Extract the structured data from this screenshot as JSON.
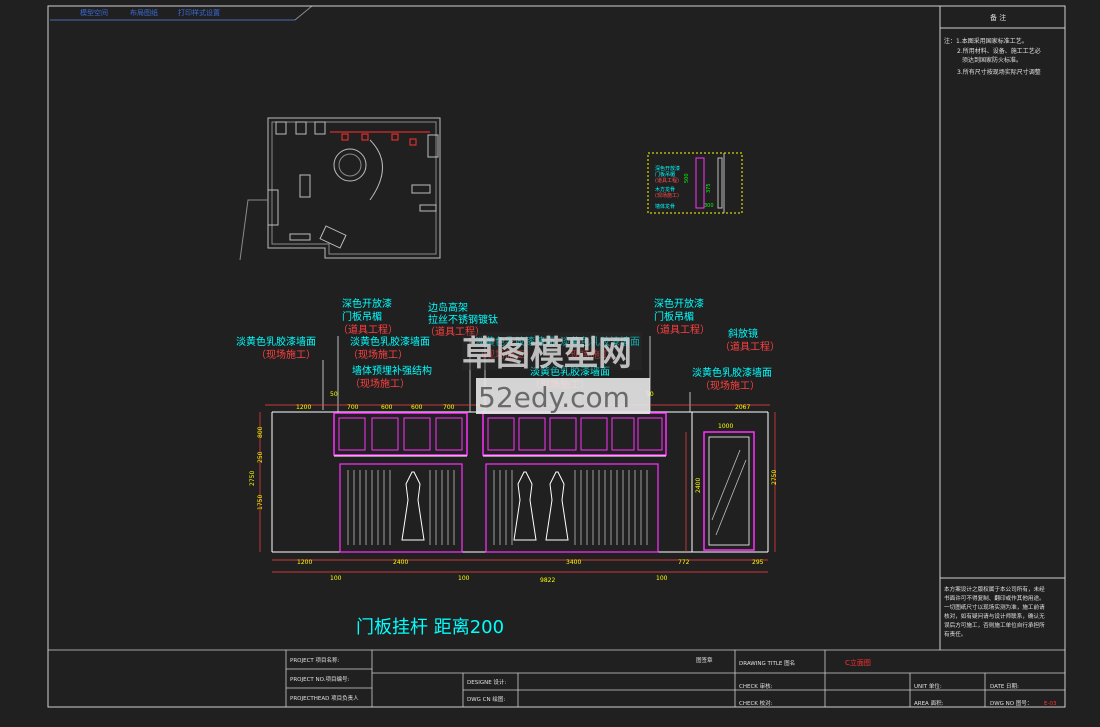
{
  "header_tabs": [
    "模型空间",
    "布局图纸",
    "打印样式设置"
  ],
  "notes": {
    "title": "备 注",
    "lines": [
      "注：1.本图采用国家标准工艺。",
      "2.所用材料、设备、施工工艺必",
      "须达到国家防火标准。",
      "3.所有尺寸按现场实际尺寸调整"
    ],
    "disclaimer": [
      "本方案设计之版权属于本公司所有，未经",
      "书面许可不得复制、翻印或作其他用途。",
      "一切图纸尺寸以现场实测为准，施工前请",
      "核对，如有疑问请与设计师联系，确认无",
      "误后方可施工，否则施工单位自行承担所",
      "有责任。"
    ]
  },
  "elevation_labels": {
    "l1": [
      "深色开放漆",
      "门板吊楣",
      "（道具工程）"
    ],
    "l2": [
      "边岛高架",
      "拉丝不锈钢镀钛",
      "（道具工程）"
    ],
    "l3": [
      "深色开放漆",
      "门板吊楣",
      "（道具工程）"
    ],
    "l4": [
      "淡黄色乳胶漆墙面",
      "（现场施工）"
    ],
    "l5": [
      "淡黄色乳胶漆墙面",
      "（现场施工）"
    ],
    "l6": [
      "墙体预埋补强结构",
      "（现场施工）"
    ],
    "l7": [
      "淡黄色乳胶漆墙面",
      "（现场施工）"
    ],
    "l8": [
      "淡黄色乳胶漆墙面",
      "（现场施工）"
    ],
    "l9": [
      "斜放镜",
      "（道具工程）"
    ],
    "l10": [
      "淡黄色乳胶漆墙面",
      "（现场施工）"
    ]
  },
  "dims": {
    "top": [
      "1200",
      "50",
      "700",
      "600",
      "600",
      "700",
      "50",
      "2067"
    ],
    "door_w": "1000",
    "left": [
      "800",
      "250",
      "2750",
      "1750"
    ],
    "right_h": [
      "2400",
      "2750"
    ],
    "bottom1": [
      "1200",
      "2400",
      "3400",
      "772",
      "295"
    ],
    "bottom2": [
      "100",
      "100",
      "9822",
      "100"
    ]
  },
  "watermark": {
    "line1": "草图模型网",
    "line2": "52edy.com"
  },
  "caption": "门板挂杆   距离200",
  "title_block": {
    "project": "PROJECT  项目名称:",
    "project_no": "PROJECT  NO.项目编号:",
    "project_head": "PROJECTHEAD 项目负责人",
    "design": "DESIGNE 设计:",
    "dwg_cn": "DWG CN   绘图:",
    "drawing_title": "DRAWING  TITLE    图名",
    "drawing_name": "C立面图",
    "check1": "CHECK    审核:",
    "check2": "CHECK    校对:",
    "unit": "UNIT    单位:",
    "date": "DATE  日期:",
    "area": "AREA  面积:",
    "dwg_no": "DWG  NO    图号：",
    "dwg_no_val": "E-03",
    "stamp": "图签章"
  },
  "detail_labels": [
    "深色开放漆",
    "门板吊楣",
    "(道具工程)",
    "木方龙骨",
    "(现场施工)",
    "墙体龙骨",
    "500",
    "375",
    "300"
  ]
}
